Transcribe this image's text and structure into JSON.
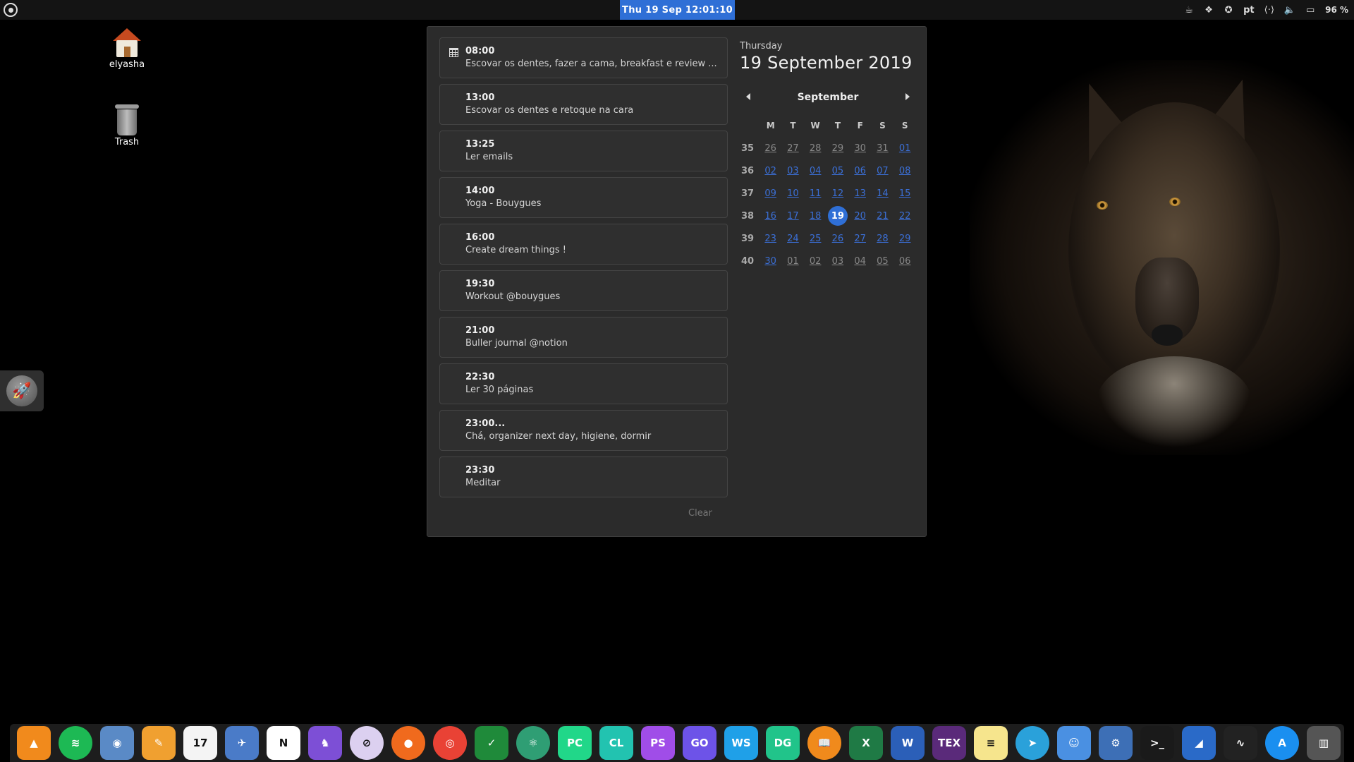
{
  "topbar": {
    "clock": "Thu 19 Sep  12:01:10",
    "tray": {
      "lang": "pt",
      "battery": "96 %",
      "icons": [
        "coffee-icon",
        "dropbox-icon",
        "accessibility-icon",
        "network-icon",
        "volume-icon",
        "battery-icon"
      ]
    }
  },
  "desktop": {
    "icons": [
      {
        "label": "elyasha",
        "icon": "home-folder-icon"
      },
      {
        "label": "Trash",
        "icon": "trash-icon"
      }
    ]
  },
  "events": [
    {
      "time": "08:00",
      "title": "Escovar os dentes, fazer a cama, breakfast e review ..."
    },
    {
      "time": "13:00",
      "title": "Escovar os dentes e retoque na cara"
    },
    {
      "time": "13:25",
      "title": "Ler emails"
    },
    {
      "time": "14:00",
      "title": "Yoga - Bouygues"
    },
    {
      "time": "16:00",
      "title": "Create dream things !"
    },
    {
      "time": "19:30",
      "title": "Workout @bouygues"
    },
    {
      "time": "21:00",
      "title": "Buller journal @notion"
    },
    {
      "time": "22:30",
      "title": "Ler 30 páginas"
    },
    {
      "time": "23:00...",
      "title": "Chá, organizer next day, higiene, dormir"
    },
    {
      "time": "23:30",
      "title": "Meditar"
    }
  ],
  "clear_label": "Clear",
  "calendar": {
    "weekday": "Thursday",
    "date": "19 September 2019",
    "month": "September",
    "headers": [
      "M",
      "T",
      "W",
      "T",
      "F",
      "S",
      "S"
    ],
    "weeks": [
      {
        "wk": "35",
        "days": [
          "26",
          "27",
          "28",
          "29",
          "30",
          "31",
          "01"
        ]
      },
      {
        "wk": "36",
        "days": [
          "02",
          "03",
          "04",
          "05",
          "06",
          "07",
          "08"
        ]
      },
      {
        "wk": "37",
        "days": [
          "09",
          "10",
          "11",
          "12",
          "13",
          "14",
          "15"
        ]
      },
      {
        "wk": "38",
        "days": [
          "16",
          "17",
          "18",
          "19",
          "20",
          "21",
          "22"
        ]
      },
      {
        "wk": "39",
        "days": [
          "23",
          "24",
          "25",
          "26",
          "27",
          "28",
          "29"
        ]
      },
      {
        "wk": "40",
        "days": [
          "30",
          "01",
          "02",
          "03",
          "04",
          "05",
          "06"
        ]
      }
    ],
    "today": "19",
    "accent": "#2f6fd6"
  },
  "dock": {
    "apps": [
      {
        "name": "vlc",
        "glyph": "▲",
        "bg": "#f18a1c"
      },
      {
        "name": "spotify",
        "glyph": "≋",
        "bg": "#1db954",
        "round": true
      },
      {
        "name": "image-capture",
        "glyph": "◉",
        "bg": "#5a8ac6"
      },
      {
        "name": "pages",
        "glyph": "✎",
        "bg": "#f0a030"
      },
      {
        "name": "calendar",
        "glyph": "17",
        "bg": "#f4f4f4",
        "dark": true
      },
      {
        "name": "preview",
        "glyph": "✈",
        "bg": "#4a7bc8"
      },
      {
        "name": "notion",
        "glyph": "N",
        "bg": "#ffffff",
        "dark": true
      },
      {
        "name": "pulse",
        "glyph": "♞",
        "bg": "#7d4fd6"
      },
      {
        "name": "tor",
        "glyph": "⊘",
        "bg": "#dcd0f0",
        "dark": true,
        "round": true
      },
      {
        "name": "firefox",
        "glyph": "●",
        "bg": "#f06a1d",
        "round": true
      },
      {
        "name": "chrome",
        "glyph": "◎",
        "bg": "#e94235",
        "round": true
      },
      {
        "name": "vim",
        "glyph": "✓",
        "bg": "#1f8a3a"
      },
      {
        "name": "atom",
        "glyph": "⚛",
        "bg": "#2f9e74",
        "round": true
      },
      {
        "name": "pycharm",
        "glyph": "PC",
        "bg": "#21d789"
      },
      {
        "name": "clion",
        "glyph": "CL",
        "bg": "#22c3b0"
      },
      {
        "name": "phpstorm",
        "glyph": "PS",
        "bg": "#a04de8"
      },
      {
        "name": "goland",
        "glyph": "GO",
        "bg": "#6d53e8"
      },
      {
        "name": "webstorm",
        "glyph": "WS",
        "bg": "#1fa0e8"
      },
      {
        "name": "datagrip",
        "glyph": "DG",
        "bg": "#21c48a"
      },
      {
        "name": "books",
        "glyph": "📖",
        "bg": "#f08a1c",
        "round": true
      },
      {
        "name": "excel",
        "glyph": "X",
        "bg": "#1f7a45"
      },
      {
        "name": "word",
        "glyph": "W",
        "bg": "#2b5fb8"
      },
      {
        "name": "tex",
        "glyph": "TEX",
        "bg": "#5a2a7a"
      },
      {
        "name": "notes",
        "glyph": "≡",
        "bg": "#f6e58d",
        "dark": true
      },
      {
        "name": "telegram",
        "glyph": "➤",
        "bg": "#2aa1da",
        "round": true
      },
      {
        "name": "finder",
        "glyph": "☺",
        "bg": "#4a90e2"
      },
      {
        "name": "system-prefs",
        "glyph": "⚙",
        "bg": "#3d6fb6"
      },
      {
        "name": "terminal",
        "glyph": ">_",
        "bg": "#1a1a1a"
      },
      {
        "name": "wireshark",
        "glyph": "◢",
        "bg": "#2a6ac8"
      },
      {
        "name": "activity-monitor",
        "glyph": "∿",
        "bg": "#222222"
      },
      {
        "name": "app-store",
        "glyph": "A",
        "bg": "#1a8ff0",
        "round": true
      },
      {
        "name": "trash",
        "glyph": "▥",
        "bg": "#555555"
      }
    ]
  }
}
